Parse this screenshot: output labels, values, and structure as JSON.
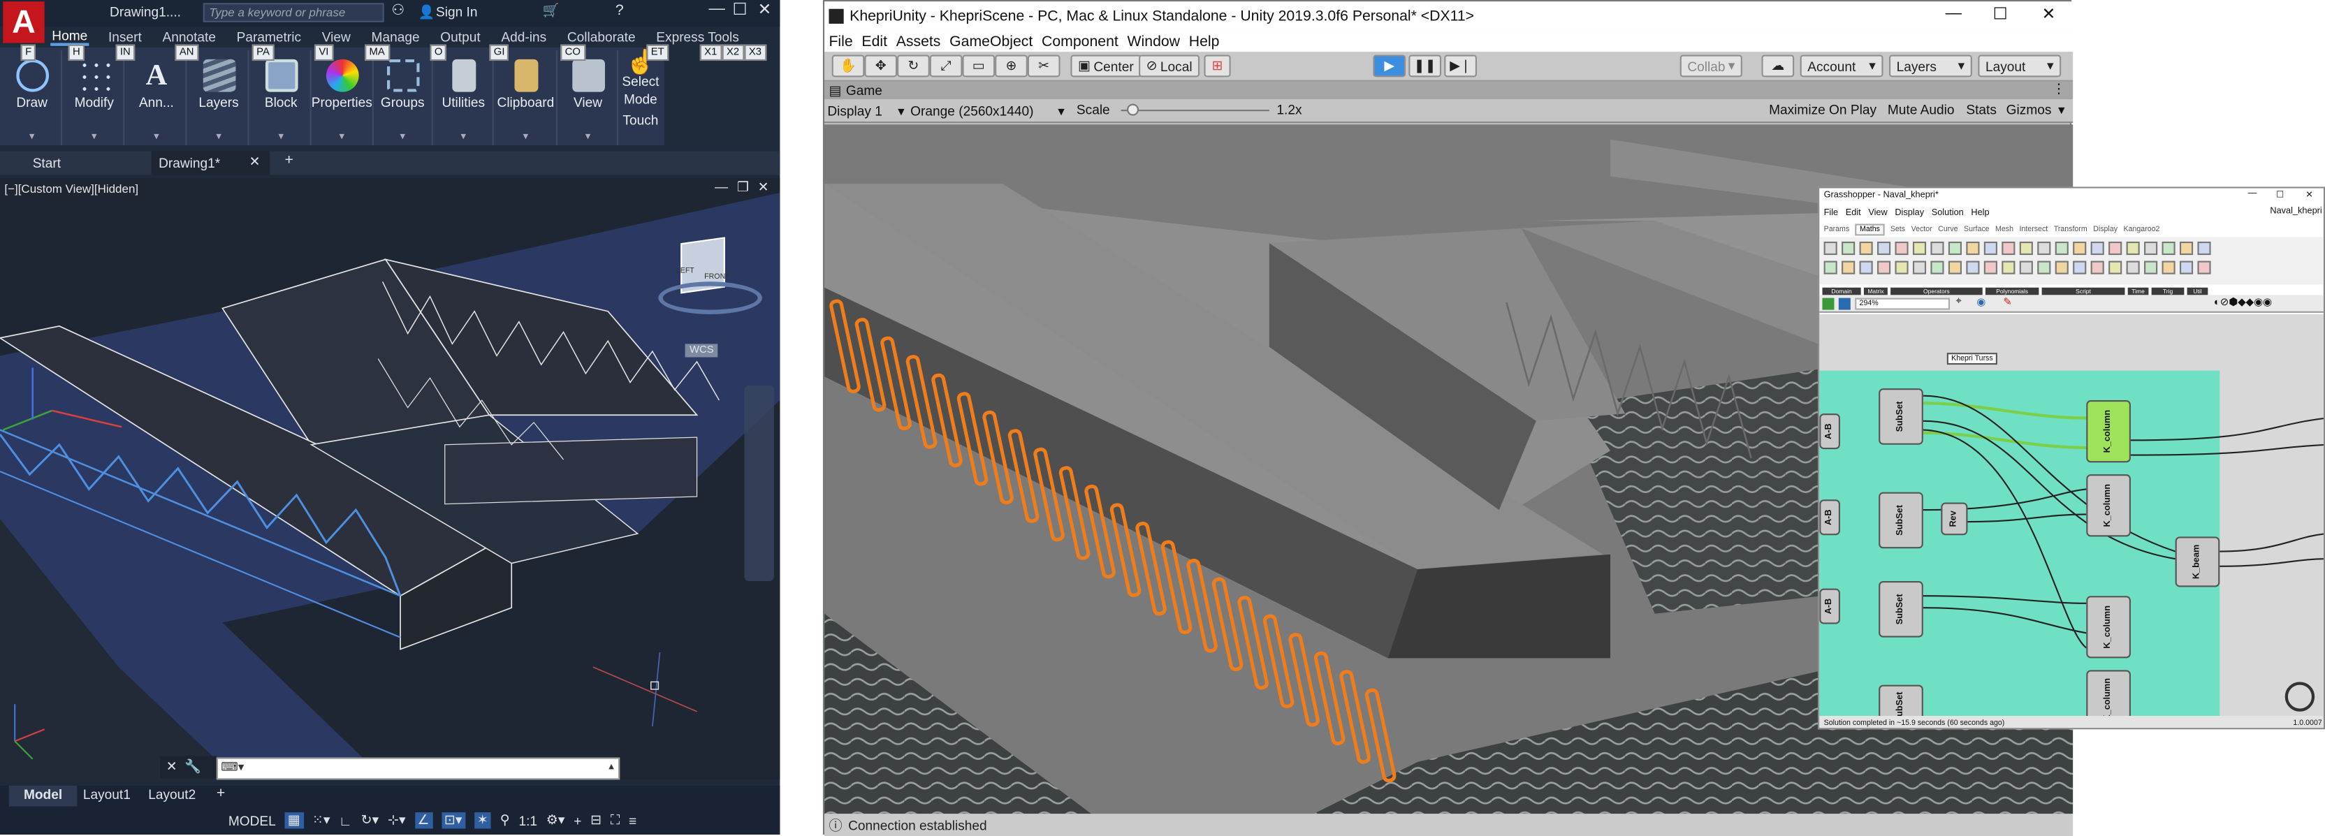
{
  "autocad": {
    "logo": "A",
    "doc_title": "Drawing1....",
    "search_placeholder": "Type a keyword or phrase",
    "sign_in": "Sign In",
    "tabs": [
      "Home",
      "Insert",
      "Annotate",
      "Parametric",
      "View",
      "Manage",
      "Output",
      "Add-ins",
      "Collaborate",
      "Express Tools"
    ],
    "panels": [
      {
        "label": "Draw",
        "key": "F"
      },
      {
        "label": "Modify",
        "key": "H"
      },
      {
        "label": "Ann...",
        "key": "IN"
      },
      {
        "label": "Layers",
        "key": "AN"
      },
      {
        "label": "Block",
        "key": "PA"
      },
      {
        "label": "Properties",
        "key": "VI"
      },
      {
        "label": "Groups",
        "key": "MA"
      },
      {
        "label": "Utilities",
        "key": "O"
      },
      {
        "label": "Clipboard",
        "key": "GI"
      },
      {
        "label": "View",
        "key": "CO"
      }
    ],
    "select_mode": {
      "line1": "Select",
      "line2": "Mode",
      "key": "ET",
      "touch": "Touch"
    },
    "extra_keys": [
      "X1",
      "X2",
      "X3"
    ],
    "doc_tabs": [
      "Start",
      "Drawing1*"
    ],
    "viewport_label": "[−][Custom View][Hidden]",
    "viewcube": {
      "face": "FRONT",
      "left": "LEFT",
      "wcs": "WCS"
    },
    "layout_tabs": [
      "Model",
      "Layout1",
      "Layout2"
    ],
    "status_model": "MODEL",
    "scale": "1:1"
  },
  "unity": {
    "title": "KhepriUnity - KhepriScene - PC, Mac & Linux Standalone - Unity 2019.3.0f6 Personal* <DX11>",
    "menu": [
      "File",
      "Edit",
      "Assets",
      "GameObject",
      "Component",
      "Window",
      "Help"
    ],
    "pivot_center": "Center",
    "pivot_local": "Local",
    "collab": "Collab",
    "account": "Account",
    "layers": "Layers",
    "layout": "Layout",
    "game_tab": "Game",
    "display": "Display 1",
    "resolution": "Orange (2560x1440)",
    "scale_label": "Scale",
    "scale_value": "1.2x",
    "game_options": [
      "Maximize On Play",
      "Mute Audio",
      "Stats",
      "Gizmos"
    ],
    "status": "Connection established",
    "accent_color": "#f07d19"
  },
  "grasshopper": {
    "title": "Grasshopper - Naval_khepri*",
    "file_name": "Naval_khepri",
    "menu": [
      "File",
      "Edit",
      "View",
      "Display",
      "Solution",
      "Help"
    ],
    "tabs": [
      "Params",
      "Maths",
      "Sets",
      "Vector",
      "Curve",
      "Surface",
      "Mesh",
      "Intersect",
      "Transform",
      "Display",
      "Kangaroo2"
    ],
    "active_tab": "Maths",
    "groups": [
      "Domain",
      "Matrix",
      "Operators",
      "Polynomials",
      "Script",
      "Time",
      "Trig",
      "Util"
    ],
    "zoom": "294%",
    "group_label": "Khepri Turss",
    "nodes": {
      "subset": "SubSet",
      "rev": "Rev",
      "column": "K_column",
      "beam": "K_beam",
      "ab": "A-B"
    },
    "status": "Solution completed in ~15.9 seconds (60 seconds ago)",
    "version": "1.0.0007",
    "canvas_color": "#6fe0c3"
  }
}
